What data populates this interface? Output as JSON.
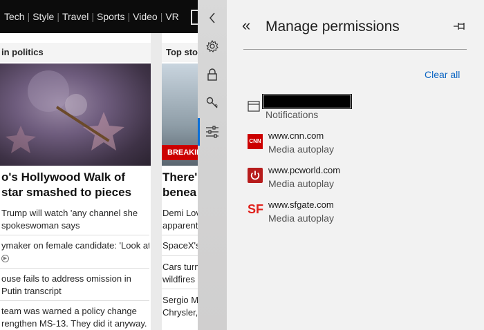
{
  "news": {
    "nav_items": [
      "Tech",
      "Style",
      "Travel",
      "Sports",
      "Video",
      "VR"
    ],
    "nav_separator": "|",
    "left_section_title": "in politics",
    "right_section_title": "Top sto",
    "breaking_badge": "BREAKIN",
    "left_headline_line1": "o's Hollywood Walk of",
    "left_headline_line2": "star smashed to pieces",
    "right_headline_line1": "There'",
    "right_headline_line2": "benea",
    "left_stories": [
      {
        "line1": "Trump will watch 'any channel she",
        "line2": "spokeswoman says"
      },
      {
        "line1": "ymaker on female candidate: 'Look at",
        "line2": ""
      },
      {
        "line1": "ouse fails to address omission in",
        "line2": "Putin transcript"
      },
      {
        "line1": "team was warned a policy change",
        "line2": "rengthen MS-13. They did it anyway."
      }
    ],
    "right_stories": [
      {
        "line1": "Demi Lov",
        "line2": "apparent"
      },
      {
        "line1": "SpaceX's",
        "line2": ""
      },
      {
        "line1": "Cars turn",
        "line2": "wildfires"
      },
      {
        "line1": "Sergio M",
        "line2": "Chrysler,"
      }
    ]
  },
  "rail": {
    "items": [
      {
        "name": "close-panel",
        "icon": "chevron-left-icon"
      },
      {
        "name": "settings",
        "icon": "gear-icon"
      },
      {
        "name": "privacy",
        "icon": "lock-icon"
      },
      {
        "name": "passwords",
        "icon": "key-icon"
      },
      {
        "name": "advanced",
        "icon": "sliders-icon",
        "active": true
      }
    ],
    "accent": "#0a6fd8"
  },
  "panel": {
    "back_glyph": "«",
    "title": "Manage permissions",
    "clear_all": "Clear all",
    "permissions": [
      {
        "site": "",
        "type": "Notifications",
        "icon": "browser-window-icon",
        "site_redacted": true
      },
      {
        "site": "www.cnn.com",
        "type": "Media autoplay",
        "icon": "cnn-icon",
        "icon_text": "CNN",
        "color": "#cc0000"
      },
      {
        "site": "www.pcworld.com",
        "type": "Media autoplay",
        "icon": "pcworld-power-icon",
        "color": "#b71c1c"
      },
      {
        "site": "www.sfgate.com",
        "type": "Media autoplay",
        "icon": "sfgate-icon",
        "icon_text": "SF",
        "color": "#e0201b"
      }
    ]
  }
}
